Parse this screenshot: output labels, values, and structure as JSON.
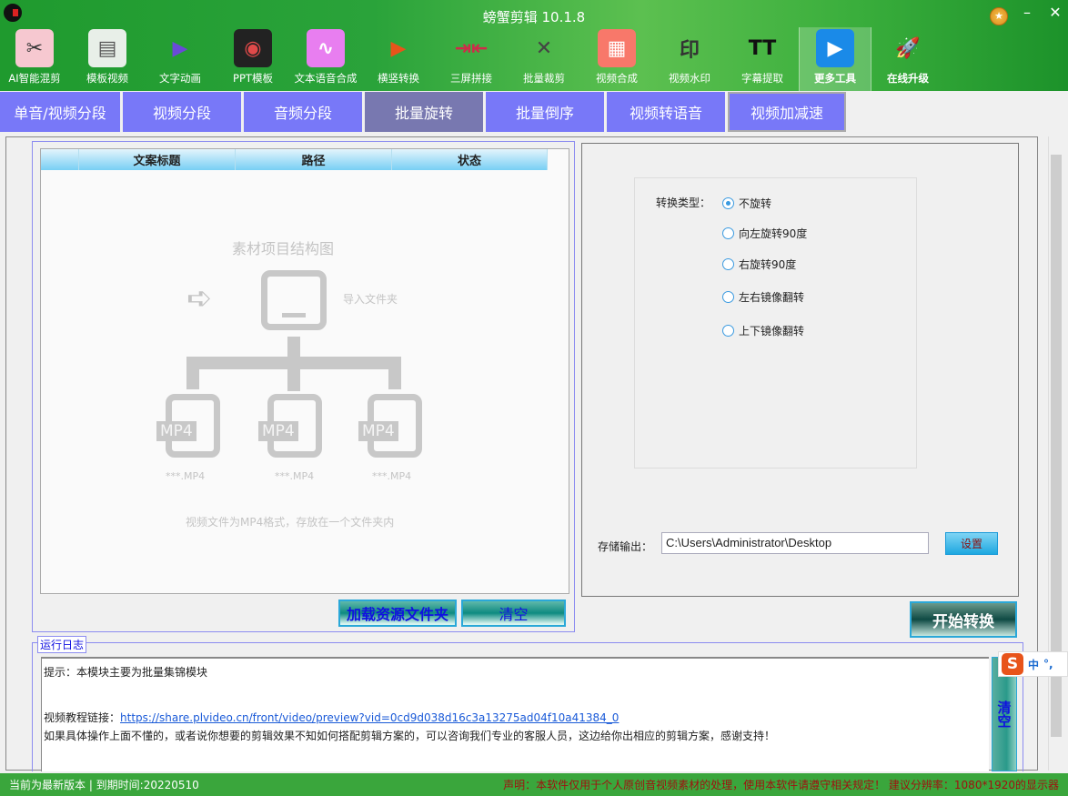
{
  "app": {
    "title": "螃蟹剪辑 10.1.8",
    "minimize": "–",
    "close": "✕",
    "medal": "★"
  },
  "toolbar": [
    {
      "label": "AI智能混剪",
      "icon": "scissors-film-icon",
      "glyph": "✂",
      "bg": "#f6c8d0",
      "fg": "#333"
    },
    {
      "label": "模板视频",
      "icon": "template-window-icon",
      "glyph": "▤",
      "bg": "#e8efe8",
      "fg": "#555"
    },
    {
      "label": "文字动画",
      "icon": "globe-play-icon",
      "glyph": "▶",
      "bg": "transparent",
      "fg": "#6a4ad8"
    },
    {
      "label": "PPT模板",
      "icon": "audio-wave-disc-icon",
      "glyph": "◉",
      "bg": "#222",
      "fg": "#e04a4a"
    },
    {
      "label": "文本语音合成",
      "icon": "voice-wave-icon",
      "glyph": "∿",
      "bg": "#e87ef0",
      "fg": "#fff"
    },
    {
      "label": "横竖转换",
      "icon": "tv-rotate-icon",
      "glyph": "▶",
      "bg": "transparent",
      "fg": "#e8541a"
    },
    {
      "label": "三屏拼接",
      "icon": "split-arrows-icon",
      "glyph": "⇥⇤",
      "bg": "transparent",
      "fg": "#d02a4a"
    },
    {
      "label": "批量裁剪",
      "icon": "crop-icon",
      "glyph": "✕",
      "bg": "transparent",
      "fg": "#444"
    },
    {
      "label": "视频合成",
      "icon": "grid-compose-icon",
      "glyph": "▦",
      "bg": "#f8786a",
      "fg": "#fff"
    },
    {
      "label": "视频水印",
      "icon": "watermark-icon",
      "glyph": "印",
      "bg": "transparent",
      "fg": "#333"
    },
    {
      "label": "字幕提取",
      "icon": "text-tt-icon",
      "glyph": "TT",
      "bg": "transparent",
      "fg": "#111"
    },
    {
      "label": "更多工具",
      "icon": "camera-tools-icon",
      "glyph": "▶",
      "bg": "#1a8ae8",
      "fg": "#fff"
    },
    {
      "label": "在线升级",
      "icon": "rocket-icon",
      "glyph": "🚀",
      "bg": "transparent",
      "fg": "#e02a2a"
    }
  ],
  "tabs": [
    "单音/视频分段",
    "视频分段",
    "音频分段",
    "批量旋转",
    "批量倒序",
    "视频转语音",
    "视频加减速"
  ],
  "table": {
    "columns": [
      "",
      "文案标题",
      "路径",
      "状态"
    ]
  },
  "placeholder": {
    "title": "素材项目结构图",
    "import": "导入文件夹",
    "tag": "MP4",
    "file": "***.MP4",
    "note": "视频文件为MP4格式，存放在一个文件夹内"
  },
  "left_buttons": {
    "load": "加载资源文件夹",
    "clear": "清空"
  },
  "convert": {
    "label": "转换类型：",
    "options": [
      "不旋转",
      "向左旋转90度",
      "右旋转90度",
      "左右镜像翻转",
      "上下镜像翻转"
    ],
    "selected": 0
  },
  "output": {
    "label": "存储输出：",
    "value": "C:\\Users\\Administrator\\Desktop",
    "set": "设置"
  },
  "start": "开始转换",
  "log": {
    "legend": "运行日志",
    "line1": "提示：本模块主要为批量集锦模块",
    "line2_prefix": "视频教程链接：",
    "link": "https://share.plvideo.cn/front/video/preview?vid=0cd9d038d16c3a13275ad04f10a41384_0",
    "line3": "如果具体操作上面不懂的，或者说你想要的剪辑效果不知如何搭配剪辑方案的，可以咨询我们专业的客服人员，这边给你出相应的剪辑方案，感谢支持！",
    "clear": "清空"
  },
  "ime": {
    "logo": "S",
    "mode": "中",
    "punct": "°,"
  },
  "status": {
    "left": "当前为最新版本 | 到期时间:20220510",
    "right": "声明：本软件仅用于个人原创音视频素材的处理，使用本软件请遵守相关规定！ 建议分辨率：1080*1920的显示器"
  },
  "colors": {
    "green": "#3aa63c",
    "tab": "#7878f8",
    "tab_active": "#7878b0"
  }
}
